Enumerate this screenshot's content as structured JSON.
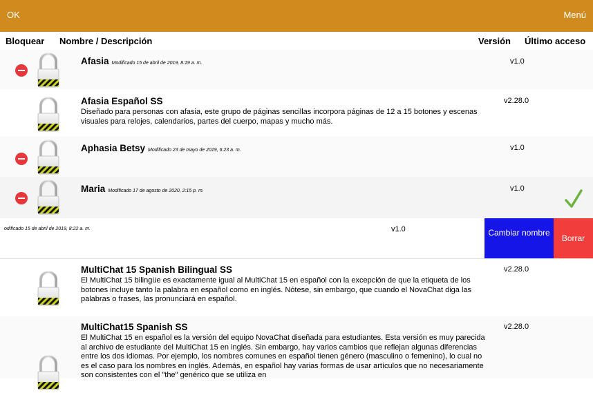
{
  "topbar": {
    "ok_label": "OK",
    "menu_label": "Menú",
    "color": "#d18a1e"
  },
  "columns": {
    "lock": "Bloquear",
    "name": "Nombre / Descripción",
    "version": "Versión",
    "last_access": "Último acceso"
  },
  "rows": [
    {
      "name": "Afasia",
      "modified": "Modificado 15 de abril de 2019, 8:19 a. m.",
      "version": "v1.0",
      "deletable": true
    },
    {
      "name": "Afasia Español SS",
      "description": "Diseñado para personas con afasia, este grupo de páginas sencillas incorpora páginas de 12 a 15 botones y escenas visuales para relojes, calendarios, partes del cuerpo, mapas y mucho más.",
      "version": "v2.28.0"
    },
    {
      "name": "Aphasia Betsy",
      "modified": "Modificado 23 de mayo de 2019, 6:23 a. m.",
      "version": "v1.0",
      "deletable": true
    },
    {
      "name": "Maria",
      "modified": "Modificado 17 de agosto de 2020, 2:15 p. m.",
      "version": "v1.0",
      "deletable": true,
      "selected": true
    },
    {
      "modified": "odificado 15 de abril de 2019, 8:22 a. m.",
      "version": "v1.0",
      "swiped": true
    },
    {
      "name": "MultiChat 15 Spanish Bilingual SS",
      "description": "El MultiChat 15 bilingüe es exactamente igual al MultiChat 15 en español con la excepción de que la etiqueta de los botones incluye tanto la palabra en español como en inglés. Nótese, sin embargo, que cuando el NovaChat diga las palabras o frases, las pronunciará en español.",
      "version": "v2.28.0"
    },
    {
      "name": "MultiChat15 Spanish SS",
      "description": "El MultiChat 15 en español es la versión del equipo NovaChat diseñada para estudiantes. Esta versión es muy parecida al archivo de estudiante del MultiChat 15 en inglés. Sin embargo, hay varios cambios que reflejan algunas diferencias entre los dos idiomas. Por ejemplo, los nombres comunes en español tienen género (masculino o femenino), lo cual no es el caso para los nombres en inglés. Además, en español hay varias formas de usar artículos que no necesariamente son consistentes con el \"the\" genérico que se utiliza en",
      "version": "v2.28.0"
    }
  ],
  "swipe_actions": {
    "rename": "Cambiar nombre",
    "delete": "Borrar",
    "rename_color": "#1515e8",
    "delete_color": "#f23d3d"
  },
  "icons": {
    "lock": "padlock-icon",
    "delete": "minus-circle-icon",
    "check": "checkmark-icon"
  }
}
